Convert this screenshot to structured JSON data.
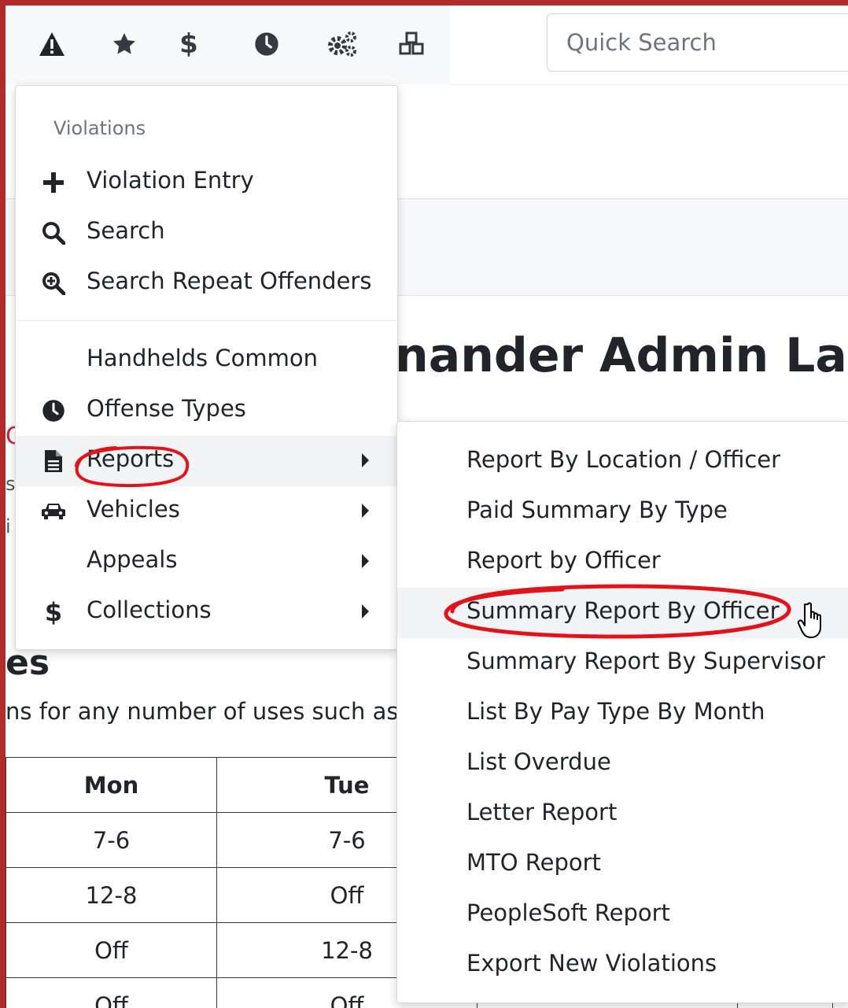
{
  "toolbar": {
    "icons": [
      "warning-icon",
      "star-icon",
      "dollar-icon",
      "clock-icon",
      "cogs-icon",
      "cubes-icon"
    ]
  },
  "search": {
    "placeholder": "Quick Search"
  },
  "page": {
    "title_fragment": "nander Admin Landi",
    "red_fragment": "C",
    "fragment_s": "s",
    "fragment_i": "i",
    "section_title_fragment": "es",
    "section_desc_fragment": "ns for any number of uses such as S"
  },
  "schedule": {
    "headers": [
      "Mon",
      "Tue",
      "",
      ""
    ],
    "rows": [
      [
        "7-6",
        "7-6",
        "",
        ""
      ],
      [
        "12-8",
        "Off",
        "",
        ""
      ],
      [
        "Off",
        "12-8",
        "",
        ""
      ],
      [
        "Off",
        "Off",
        "",
        ""
      ]
    ]
  },
  "menu": {
    "header": "Violations",
    "items": [
      {
        "label": "Violation Entry",
        "icon": "plus-icon",
        "submenu": false
      },
      {
        "label": "Search",
        "icon": "search-icon",
        "submenu": false
      },
      {
        "label": "Search Repeat Offenders",
        "icon": "search-plus-icon",
        "submenu": false
      },
      {
        "label": "Handhelds Common",
        "icon": "",
        "submenu": false
      },
      {
        "label": "Offense Types",
        "icon": "clock-icon",
        "submenu": false
      },
      {
        "label": "Reports",
        "icon": "file-icon",
        "submenu": true,
        "active": true
      },
      {
        "label": "Vehicles",
        "icon": "car-icon",
        "submenu": true
      },
      {
        "label": "Appeals",
        "icon": "",
        "submenu": true
      },
      {
        "label": "Collections",
        "icon": "dollar-icon",
        "submenu": true
      }
    ]
  },
  "submenu": {
    "items": [
      "Report By Location / Officer",
      "Paid Summary By Type",
      "Report by Officer",
      "Summary Report By Officer",
      "Summary Report By Supervisor",
      "List By Pay Type By Month",
      "List Overdue",
      "Letter Report",
      "MTO Report",
      "PeopleSoft Report",
      "Export New Violations"
    ],
    "hovered_index": 3
  },
  "colors": {
    "annotation_red": "#e0141a",
    "frame_border": "#b22a2a"
  }
}
